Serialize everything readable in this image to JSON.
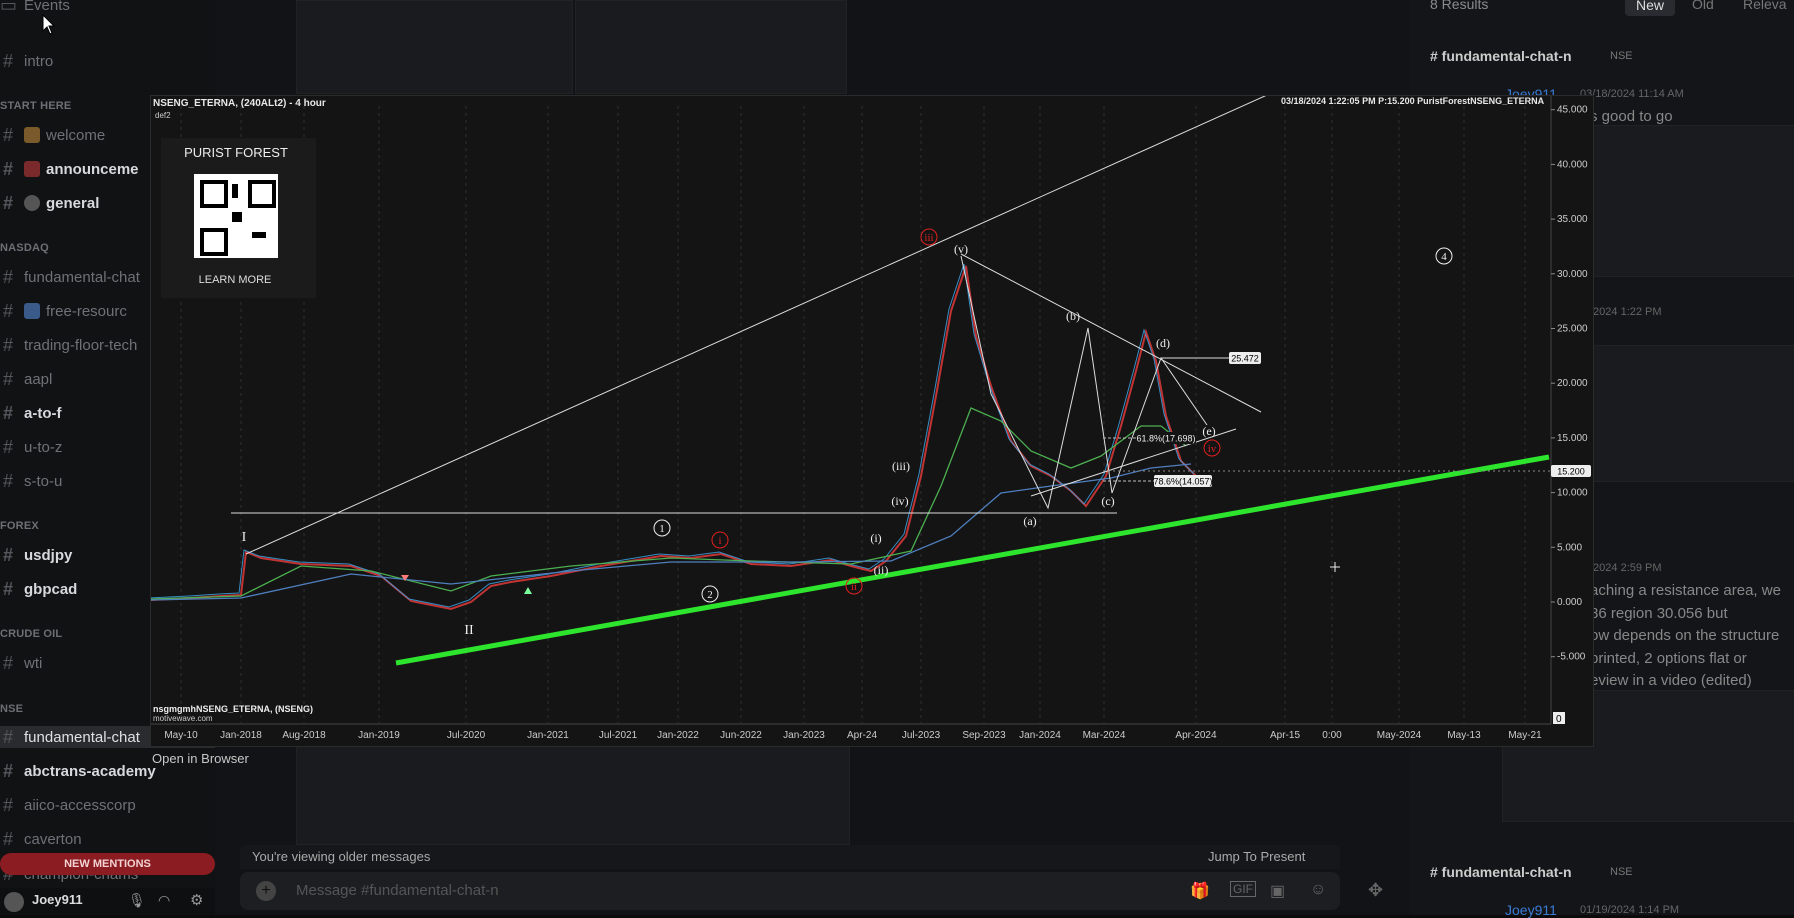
{
  "sidebar": {
    "top_item": "Events",
    "intro": "intro",
    "categories": [
      {
        "label": "START HERE",
        "channels": [
          "welcome",
          "announceme",
          "general"
        ]
      },
      {
        "label": "NASDAQ",
        "channels": [
          "fundamental-chat",
          "free-resourc",
          "trading-floor-tech",
          "aapl",
          "a-to-f",
          "u-to-z",
          "s-to-u"
        ]
      },
      {
        "label": "FOREX",
        "channels": [
          "usdjpy",
          "gbpcad"
        ]
      },
      {
        "label": "CRUDE OIL",
        "channels": [
          "wti"
        ]
      },
      {
        "label": "NSE",
        "channels": [
          "fundamental-chat",
          "abctrans-academy",
          "aiico-accesscorp",
          "caverton",
          "champion-chams"
        ]
      }
    ],
    "new_mentions": "NEW MENTIONS",
    "username": "Joey911"
  },
  "right_panel": {
    "results": "8 Results",
    "tabs": [
      "New",
      "Old",
      "Releva"
    ],
    "result1_channel": "# fundamental-chat-n",
    "result1_tag": "NSE",
    "result1_user": "Joey911",
    "result1_time": "03/18/2024 11:14 AM",
    "result1_text": "s good to go",
    "result2_time": "/2024 1:22 PM",
    "result3_time": "/2024 2:59 PM",
    "result3_lines": [
      "aching a resistance area, we",
      "86 region 30.056 but",
      "ow depends on the structure",
      "printed, 2 options flat or",
      "eview in  a video (edited)"
    ],
    "result4_channel": "# fundamental-chat-n",
    "result4_tag": "NSE",
    "result4_user": "Joey911",
    "result4_time": "01/19/2024 1:14 PM"
  },
  "composer": {
    "older_text": "You're viewing older messages",
    "jump_label": "Jump To Present",
    "placeholder": "Message #fundamental-chat-n"
  },
  "chart": {
    "title": "NSENG_ETERNA, (240ALt2) - 4 hour",
    "subtitle": "def2",
    "header_right": "03/18/2024 1:22:05 PM   P:15.200  PuristForestNSENG_ETERNA",
    "watermark_title": "PURIST FOREST",
    "watermark_link": "LEARN MORE",
    "footer_symbol": "nsgmgmhNSENG_ETERNA, (NSENG)",
    "footer_site": "motivewave.com",
    "open_in_browser": "Open in Browser",
    "price_marker": "15.200",
    "label_target": "25.472",
    "fib_618": "61.8%(17.698)",
    "fib_786": "78.6%(14.057)",
    "y_ticks": [
      "45.000",
      "40.000",
      "35.000",
      "30.000",
      "25.000",
      "20.000",
      "15.000",
      "10.000",
      "5.000",
      "0.000",
      "-5.000"
    ],
    "x_ticks": [
      "May-10",
      "Jan-2018",
      "Aug-2018",
      "Jan-2019",
      "Jul-2020",
      "Jan-2021",
      "Jul-2021",
      "Jan-2022",
      "Jun-2022",
      "Jan-2023",
      "Apr-24",
      "Jul-2023",
      "Sep-2023",
      "Jan-2024",
      "Mar-2024",
      "Apr-2024",
      "Apr-15",
      "0:00",
      "May-2024",
      "May-13",
      "May-21"
    ],
    "wave_labels": {
      "I": "I",
      "II": "II",
      "c1": "1",
      "c2": "2",
      "c4": "4",
      "i": "(i)",
      "ii": "(ii)",
      "iii": "(iii)",
      "iv": "(iv)",
      "v": "(v)",
      "a": "(a)",
      "b": "(b)",
      "c": "(c)",
      "d": "(d)",
      "e": "(e)",
      "red_iii": "iii",
      "red_iv": "iv",
      "red_i": "i",
      "red_ii": "ii"
    },
    "corner_zero": "0",
    "colors": {
      "support": "#2ee52e",
      "bull": "#3a9bd9",
      "bear": "#e03a3a",
      "ma_green": "#4caf50",
      "ma_blue": "#4f7fbf",
      "red_label": "#e02020"
    }
  }
}
